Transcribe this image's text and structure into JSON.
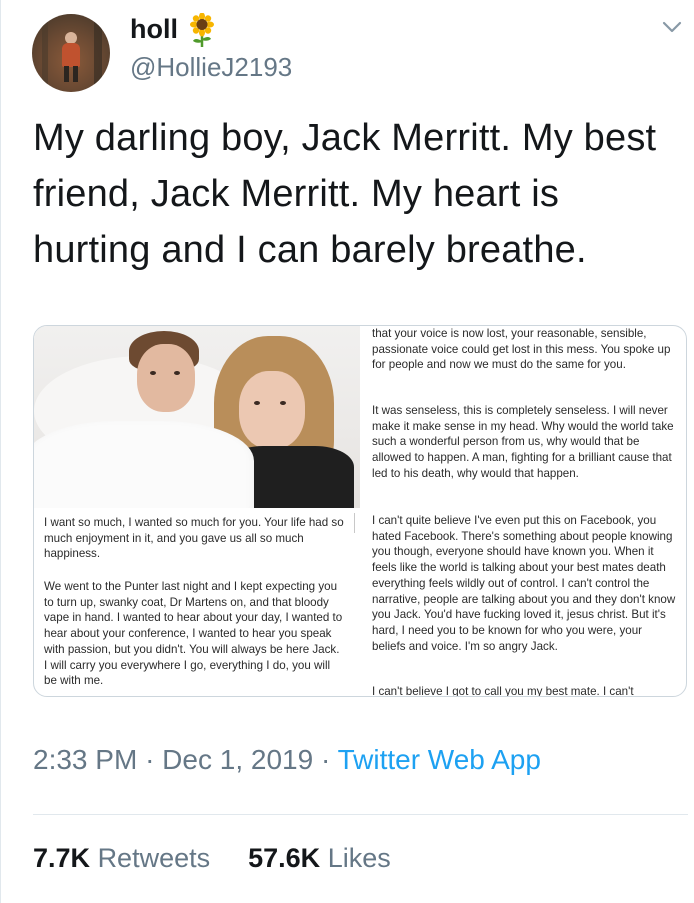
{
  "user": {
    "display_name": "holl",
    "emoji": "sunflower-emoji",
    "handle": "@HollieJ2193"
  },
  "tweet": {
    "text": "My darling boy, Jack Merritt. My best friend, Jack Merritt. My heart is hurting and I can barely breathe."
  },
  "attached_image": {
    "left_paragraphs": [
      "I want so much, I wanted so much for you. Your life had so much enjoyment in it, and you gave us all so much happiness.",
      "We went to the Punter last night and I kept expecting you to turn up, swanky coat, Dr Martens on, and that bloody vape in hand. I wanted to hear about your day, I wanted to hear about your conference, I wanted to hear you speak with passion, but you didn't. You will always be here Jack. I will carry you everywhere I go, everything I do, you will be with me."
    ],
    "right_paragraphs": [
      "that your voice is now lost, your reasonable, sensible, passionate voice could get lost in this mess. You spoke up for people and now we must do the same for you.",
      "It was senseless, this is completely senseless. I will never make it make sense in my head. Why would the world take such a wonderful person from us, why would that be allowed to happen. A man, fighting for a brilliant cause that led to his death, why would that happen.",
      "I can't quite believe I've even put this on Facebook, you hated Facebook. There's something about people knowing you though, everyone should have known you. When it feels like the world is talking about your best mates death everything feels wildly out of control. I can't control the narrative, people are talking about you and they don't know you Jack. You'd have fucking loved it, jesus christ. But it's hard, I need you to be known for who you were, your beliefs and voice. I'm so angry Jack.",
      "I can't believe I got to call you my best mate. I can't"
    ]
  },
  "meta": {
    "time": "2:33 PM",
    "separator": "·",
    "date": "Dec 1, 2019",
    "app": "Twitter Web App"
  },
  "stats": {
    "retweets_count": "7.7K",
    "retweets_label": "Retweets",
    "likes_count": "57.6K",
    "likes_label": "Likes"
  },
  "colors": {
    "link": "#1da1f2",
    "secondary_text": "#657786",
    "primary_text": "#14171a"
  }
}
